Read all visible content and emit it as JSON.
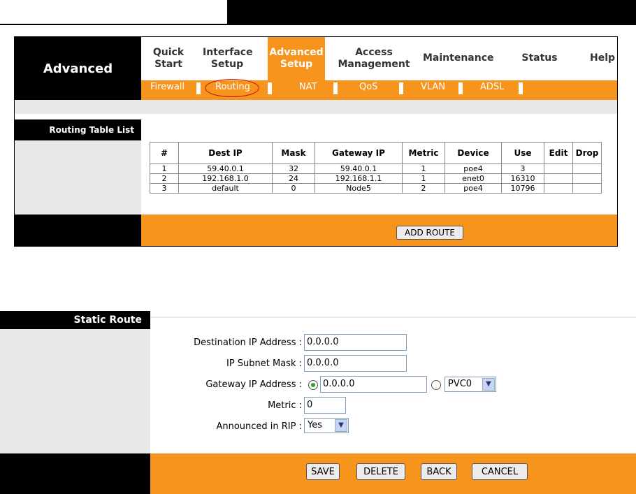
{
  "brand": "Advanced",
  "nav": [
    {
      "label_1": "Quick",
      "label_2": "Start"
    },
    {
      "label_1": "Interface",
      "label_2": "Setup"
    },
    {
      "label_1": "Advanced",
      "label_2": "Setup"
    },
    {
      "label_1": "Access",
      "label_2": "Management"
    },
    {
      "label_1": "Maintenance",
      "label_2": ""
    },
    {
      "label_1": "Status",
      "label_2": ""
    },
    {
      "label_1": "Help",
      "label_2": ""
    }
  ],
  "subnav": [
    "Firewall",
    "Routing",
    "NAT",
    "QoS",
    "VLAN",
    "ADSL"
  ],
  "routing_section_label": "Routing Table List",
  "routing_table": {
    "headers": [
      "#",
      "Dest IP",
      "Mask",
      "Gateway IP",
      "Metric",
      "Device",
      "Use",
      "Edit",
      "Drop"
    ],
    "rows": [
      [
        "1",
        "59.40.0.1",
        "32",
        "59.40.0.1",
        "1",
        "poe4",
        "3",
        "",
        ""
      ],
      [
        "2",
        "192.168.1.0",
        "24",
        "192.168.1.1",
        "1",
        "enet0",
        "16310",
        "",
        ""
      ],
      [
        "3",
        "default",
        "0",
        "Node5",
        "2",
        "poe4",
        "10796",
        "",
        ""
      ]
    ]
  },
  "add_route_label": "ADD ROUTE",
  "static_route": {
    "section_label": "Static Route",
    "dest_ip_label": "Destination IP Address :",
    "dest_ip_value": "0.0.0.0",
    "subnet_label": "IP Subnet Mask :",
    "subnet_value": "0.0.0.0",
    "gateway_label": "Gateway IP Address :",
    "gateway_value": "0.0.0.0",
    "pvc_value": "PVC0",
    "metric_label": "Metric :",
    "metric_value": "0",
    "rip_label": "Announced in RIP :",
    "rip_value": "Yes",
    "buttons": {
      "save": "SAVE",
      "delete": "DELETE",
      "back": "BACK",
      "cancel": "CANCEL"
    }
  },
  "colors": {
    "accent": "#f7941d",
    "dark": "#000000",
    "panel_grey": "#e8e8e8",
    "highlight_circle": "#cc0000"
  }
}
